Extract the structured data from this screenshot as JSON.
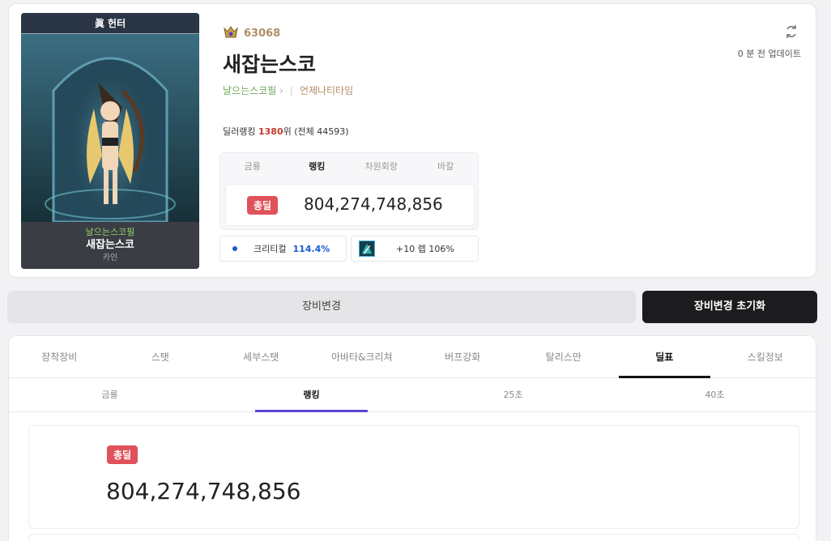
{
  "character": {
    "class_title": "眞 헌터",
    "adventure_name": "날으는스코필",
    "name": "새잡는스코",
    "server": "카인",
    "fame": "63068",
    "guild": "언제나티타임",
    "updated": "0 분 전 업데이트"
  },
  "ranking": {
    "prefix": "딜러랭킹 ",
    "rank": "1380",
    "suffix": "위 (전체 44593)"
  },
  "mini_panel": {
    "tabs": [
      "금룡",
      "랭킹",
      "차원회랑",
      "바칼"
    ],
    "active_tab": "랭킹",
    "badge": "총딜",
    "value": "804,274,748,856"
  },
  "stats": {
    "crit_label": "크리티컬",
    "crit_value": "114.4%",
    "skill_label": "+10 렙 106%"
  },
  "buttons": {
    "equip_change": "장비변경",
    "equip_reset": "장비변경 초기화"
  },
  "main_tabs": [
    "장착장비",
    "스탯",
    "세부스탯",
    "아바타&크리쳐",
    "버프강화",
    "탈리스만",
    "딜표",
    "스킬정보"
  ],
  "main_tab_active": "딜표",
  "sub_tabs": [
    "금룡",
    "랭킹",
    "25초",
    "40초"
  ],
  "sub_tab_active": "랭킹",
  "result": {
    "badge": "총딜",
    "value": "804,274,748,856"
  },
  "colors": {
    "badge": "#e0525a",
    "rank_number": "#c0392b",
    "crit_value": "#1a5ad6",
    "sub_tab_indicator": "#5a46d6",
    "fame": "#b08e63"
  }
}
